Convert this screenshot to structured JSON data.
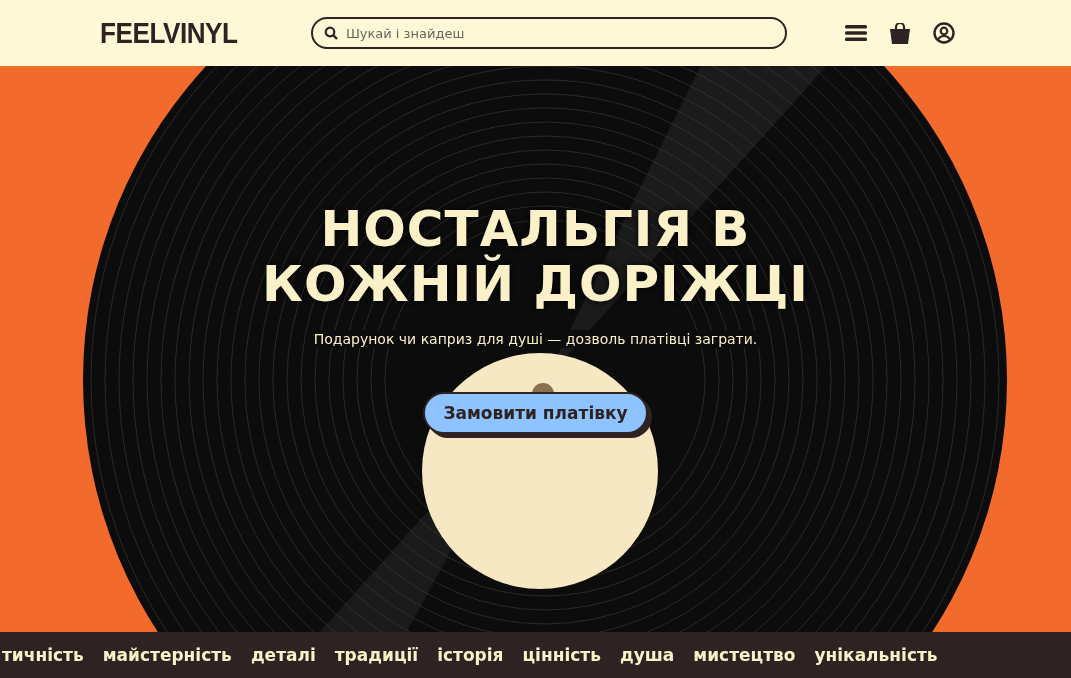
{
  "header": {
    "logo": "FEELVINYL",
    "search": {
      "placeholder": "Шукай і знайдеш"
    }
  },
  "hero": {
    "title_lines": [
      "НОСТАЛЬГІЯ В",
      "КОЖНІЙ ДОРІЖЦІ"
    ],
    "subtitle": "Подарунок чи каприз для душі — дозволь платівці заграти.",
    "button": "Замовити платівку"
  },
  "ticker": [
    "тичність",
    "майстерність",
    "деталі",
    "традиції",
    "історія",
    "цінність",
    "душа",
    "мистецтво",
    "унікальність"
  ]
}
